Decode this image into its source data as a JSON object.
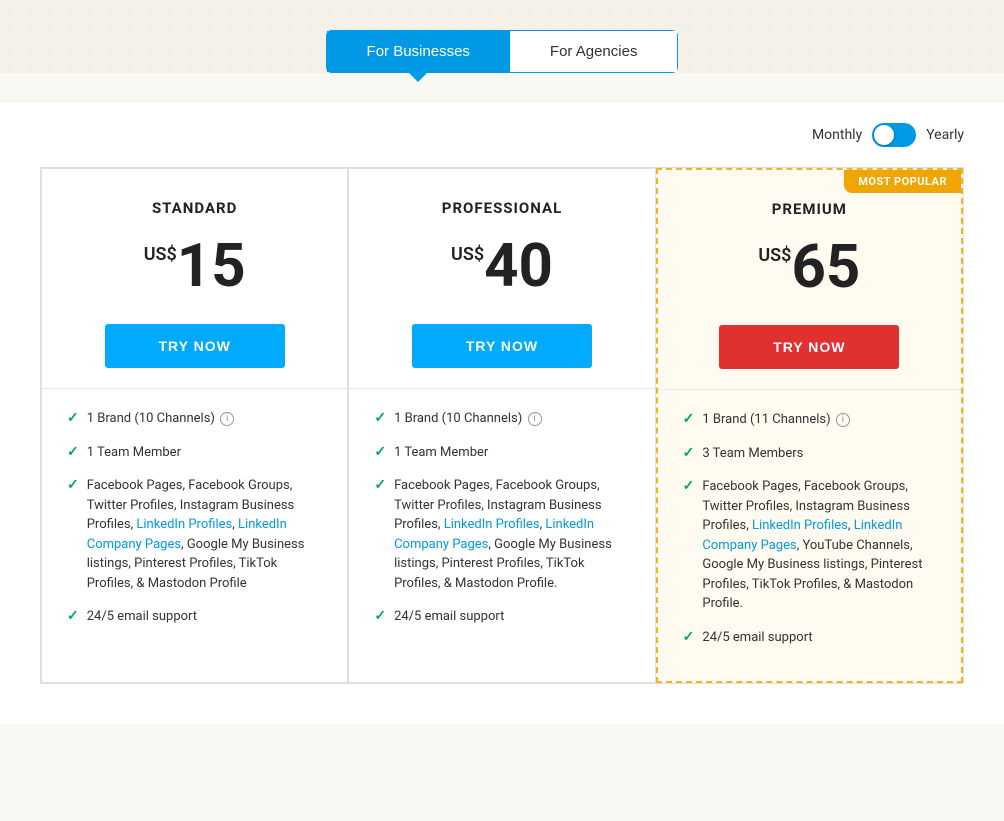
{
  "tabs": {
    "businesses_label": "For Businesses",
    "agencies_label": "For Agencies",
    "active": "businesses"
  },
  "billing": {
    "monthly_label": "Monthly",
    "yearly_label": "Yearly"
  },
  "plans": [
    {
      "id": "standard",
      "name": "STANDARD",
      "currency": "US$",
      "price": "15",
      "cta_label": "TRY NOW",
      "cta_style": "blue",
      "most_popular": false,
      "features": [
        "1 Brand (10 Channels)",
        "1 Team Member",
        "Facebook Pages, Facebook Groups, Twitter Profiles, Instagram Business Profiles, LinkedIn Profiles, LinkedIn Company Pages, Google My Business listings, Pinterest Profiles, TikTok Profiles, & Mastodon Profile",
        "24/5 email support"
      ]
    },
    {
      "id": "professional",
      "name": "PROFESSIONAL",
      "currency": "US$",
      "price": "40",
      "cta_label": "TRY NOW",
      "cta_style": "blue",
      "most_popular": false,
      "features": [
        "1 Brand (10 Channels)",
        "1 Team Member",
        "Facebook Pages, Facebook Groups, Twitter Profiles, Instagram Business Profiles, LinkedIn Profiles, LinkedIn Company Pages, Google My Business listings, Pinterest Profiles, TikTok Profiles, & Mastodon Profile.",
        "24/5 email support"
      ]
    },
    {
      "id": "premium",
      "name": "PREMIUM",
      "currency": "US$",
      "price": "65",
      "cta_label": "TRY NOW",
      "cta_style": "red",
      "most_popular": true,
      "most_popular_label": "MOST POPULAR",
      "features": [
        "1 Brand (11 Channels)",
        "3 Team Members",
        "Facebook Pages, Facebook Groups, Twitter Profiles, Instagram Business Profiles, LinkedIn Profiles, LinkedIn Company Pages, YouTube Channels, Google My Business listings, Pinterest Profiles, TikTok Profiles, & Mastodon Profile.",
        "24/5 email support"
      ]
    }
  ]
}
